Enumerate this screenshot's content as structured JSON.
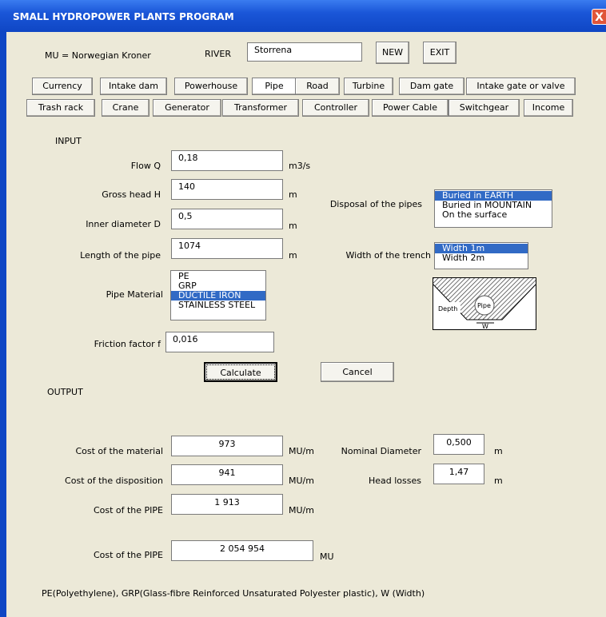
{
  "window": {
    "title": "SMALL HYDROPOWER PLANTS  PROGRAM",
    "close_label": "X"
  },
  "header": {
    "mu_text": "MU = Norwegian Kroner",
    "river_label": "RIVER",
    "river_value": "Storrena",
    "new_label": "NEW",
    "exit_label": "EXIT"
  },
  "tabs_row1": [
    "Currency",
    "Intake dam",
    "Powerhouse",
    "Pipe",
    "Road",
    "Turbine",
    "Dam gate",
    "Intake gate or valve"
  ],
  "tabs_row2": [
    "Trash rack",
    "Crane",
    "Generator",
    "Transformer",
    "Controller",
    "Power Cable",
    "Switchgear",
    "Income"
  ],
  "selected_tab": "Pipe",
  "input": {
    "section_label": "INPUT",
    "flow": {
      "label": "Flow Q",
      "value": "0,18",
      "unit": "m3/s"
    },
    "head": {
      "label": "Gross head H",
      "value": "140",
      "unit": "m"
    },
    "diameter": {
      "label": "Inner diameter D",
      "value": "0,5",
      "unit": "m"
    },
    "length": {
      "label": "Length of the pipe",
      "value": "1074",
      "unit": "m"
    },
    "material": {
      "label": "Pipe Material",
      "options": [
        "PE",
        "GRP",
        "DUCTILE IRON",
        "STAINLESS STEEL"
      ],
      "selected": "DUCTILE IRON"
    },
    "friction": {
      "label": "Friction factor f",
      "value": "0,016"
    },
    "disposal": {
      "label": "Disposal of the pipes",
      "options": [
        "Buried in EARTH",
        "Buried in MOUNTAIN",
        "On the surface"
      ],
      "selected": "Buried in EARTH"
    },
    "trench": {
      "label": "Width of the trench",
      "options": [
        "Width 1m",
        "Width 2m"
      ],
      "selected": "Width 1m"
    },
    "diagram": {
      "depth_label": "Depth",
      "pipe_label": "Pipe",
      "w_label": "W"
    }
  },
  "actions": {
    "calculate_label": "Calculate",
    "cancel_label": "Cancel"
  },
  "output": {
    "section_label": "OUTPUT",
    "material_cost": {
      "label": "Cost of the material",
      "value": "973",
      "unit": "MU/m"
    },
    "disposition_cost": {
      "label": "Cost of the disposition",
      "value": "941",
      "unit": "MU/m"
    },
    "pipe_cost_per_m": {
      "label": "Cost of the PIPE",
      "value": "1 913",
      "unit": "MU/m"
    },
    "pipe_cost_total": {
      "label": "Cost of the PIPE",
      "value": "2 054 954",
      "unit": "MU"
    },
    "nominal_diameter": {
      "label": "Nominal Diameter",
      "value": "0,500",
      "unit": "m"
    },
    "head_losses": {
      "label": "Head losses",
      "value": "1,47",
      "unit": "m"
    }
  },
  "footnote": "PE(Polyethylene), GRP(Glass-fibre Reinforced Unsaturated Polyester plastic), W (Width)"
}
